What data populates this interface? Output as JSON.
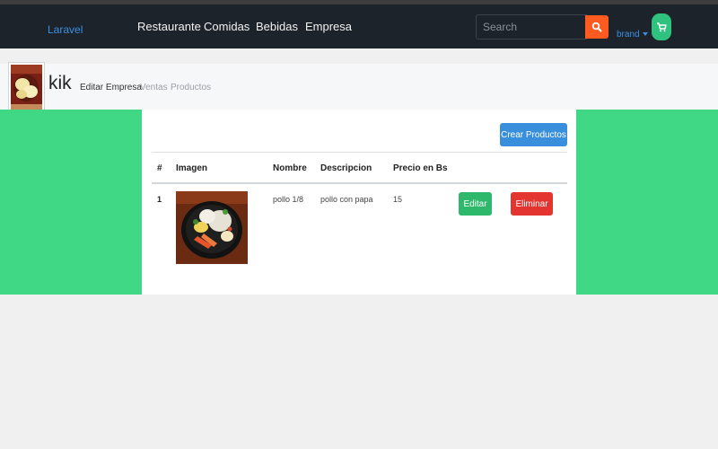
{
  "navbar": {
    "brand": "Laravel",
    "links": [
      "Restaurante",
      "Comidas",
      "Bebidas",
      "Empresa"
    ],
    "search": {
      "placeholder": "Search",
      "icon": "search-icon"
    },
    "user_label": "brand",
    "cart_icon": "cart-icon"
  },
  "company": {
    "name": "kik",
    "links": [
      {
        "label": "Editar Empresa",
        "active": true
      },
      {
        "label": "Ventas",
        "active": false
      },
      {
        "label": "Productos",
        "active": false
      }
    ]
  },
  "products": {
    "create_label": "Crear Productos",
    "columns": [
      "#",
      "Imagen",
      "Nombre",
      "Descripcion",
      "Precio en Bs"
    ],
    "rows": [
      {
        "id": "1",
        "name": "pollo 1/8",
        "description": "pollo con papa",
        "price": "15",
        "edit_label": "Editar",
        "delete_label": "Eliminar"
      }
    ]
  },
  "colors": {
    "navbar_bg": "#1c232b",
    "accent_blue": "#3a8fdc",
    "band_green": "#40d884",
    "search_orange": "#ff5a1f",
    "edit_green": "#2eb86c",
    "delete_red": "#e3342f"
  }
}
